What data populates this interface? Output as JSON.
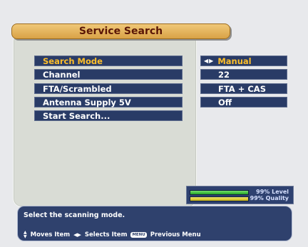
{
  "title": "Service Search",
  "menu": {
    "items": [
      {
        "label": "Search Mode",
        "selected": true
      },
      {
        "label": "Channel",
        "selected": false
      },
      {
        "label": "FTA/Scrambled",
        "selected": false
      },
      {
        "label": "Antenna Supply 5V",
        "selected": false
      },
      {
        "label": "Start Search...",
        "selected": false
      }
    ]
  },
  "values": [
    {
      "value": "Manual",
      "selected": true
    },
    {
      "value": "22",
      "selected": false
    },
    {
      "value": "FTA + CAS",
      "selected": false
    },
    {
      "value": "Off",
      "selected": false
    }
  ],
  "signal": {
    "level_percent": "99%",
    "level_label": "Level",
    "quality_percent": "99%",
    "quality_label": "Quality",
    "level_value": 99,
    "quality_value": 99,
    "level_color": "#35b83a",
    "quality_color": "#e4d33e"
  },
  "help": {
    "text": "Select the scanning mode.",
    "hint_move": "Moves Item",
    "hint_select": "Selects Item",
    "menu_key": "MENU",
    "hint_menu": "Previous Menu"
  },
  "icons": {
    "move": "up-down-arrows-icon",
    "select": "left-right-arrows-icon",
    "menu": "menu-key-icon"
  },
  "colors": {
    "accent": "#ffbf2a",
    "title_text": "#5a1606",
    "menu_bg": "#293b66",
    "panel_bg": "#d9dcd5",
    "page_bg": "#e8e9ec"
  }
}
